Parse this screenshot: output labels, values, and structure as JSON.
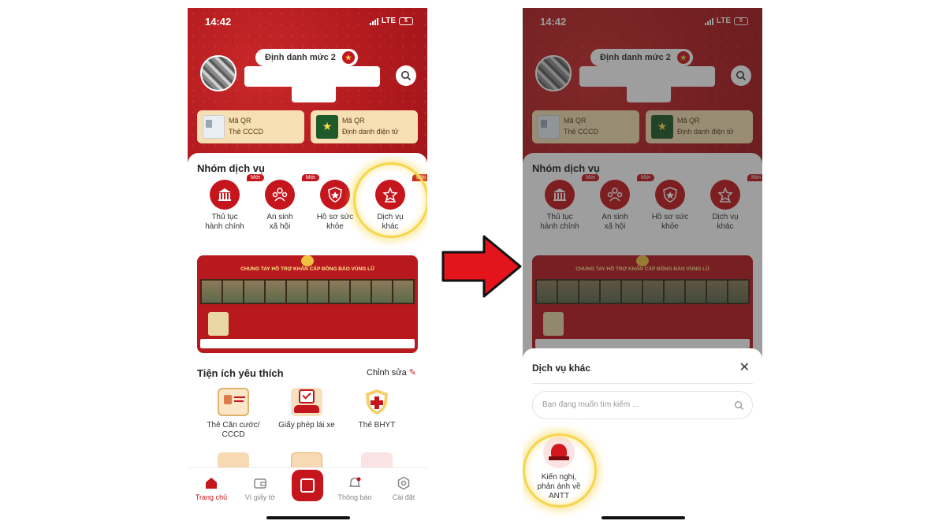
{
  "status": {
    "time": "14:42",
    "network": "LTE",
    "battery": "5"
  },
  "profile": {
    "level_label": "Định danh mức 2"
  },
  "qr_cards": [
    {
      "line1": "Mã QR",
      "line2": "Thẻ CCCD"
    },
    {
      "line1": "Mã QR",
      "line2": "Định danh điện tử"
    }
  ],
  "service_group": {
    "title": "Nhóm dịch vụ",
    "new_badge": "Mới",
    "items": [
      {
        "label_1": "Thủ tục",
        "label_2": "hành chính",
        "icon": "building-icon"
      },
      {
        "label_1": "An sinh",
        "label_2": "xã hội",
        "icon": "family-icon"
      },
      {
        "label_1": "Hồ sơ sức",
        "label_2": "khỏe",
        "icon": "health-shield-icon"
      },
      {
        "label_1": "Dịch vụ",
        "label_2": "khác",
        "icon": "star-icon"
      }
    ]
  },
  "banner": {
    "title": "CHUNG TAY HỖ TRỢ KHẨN CẤP ĐỒNG BÀO VÙNG LŨ"
  },
  "favorites": {
    "title": "Tiện ích yêu thích",
    "edit_label": "Chỉnh sửa",
    "items": [
      {
        "label_1": "Thẻ Căn cước/",
        "label_2": "CCCD",
        "icon": "id-card-icon"
      },
      {
        "label_1": "Giấy phép lái xe",
        "label_2": "",
        "icon": "driver-license-icon"
      },
      {
        "label_1": "Thẻ BHYT",
        "label_2": "",
        "icon": "health-insurance-icon"
      }
    ]
  },
  "tabbar": {
    "items": [
      {
        "label": "Trang chủ",
        "icon": "home-icon"
      },
      {
        "label": "Ví giấy tờ",
        "icon": "wallet-icon"
      },
      {
        "label": "",
        "icon": "scan-icon"
      },
      {
        "label": "Thông báo",
        "icon": "bell-icon"
      },
      {
        "label": "Cài đặt",
        "icon": "settings-icon"
      }
    ]
  },
  "sheet": {
    "title": "Dịch vụ khác",
    "search_placeholder": "Bạn đang muốn tìm kiếm ...",
    "item": {
      "label_1": "Kiến nghị,",
      "label_2": "phản ánh về",
      "label_3": "ANTT",
      "icon": "siren-icon"
    }
  },
  "colors": {
    "brand_red": "#c4161c",
    "card_gold": "#f6dfb3",
    "highlight": "#f7d54a",
    "arrow_red": "#e3141b"
  }
}
